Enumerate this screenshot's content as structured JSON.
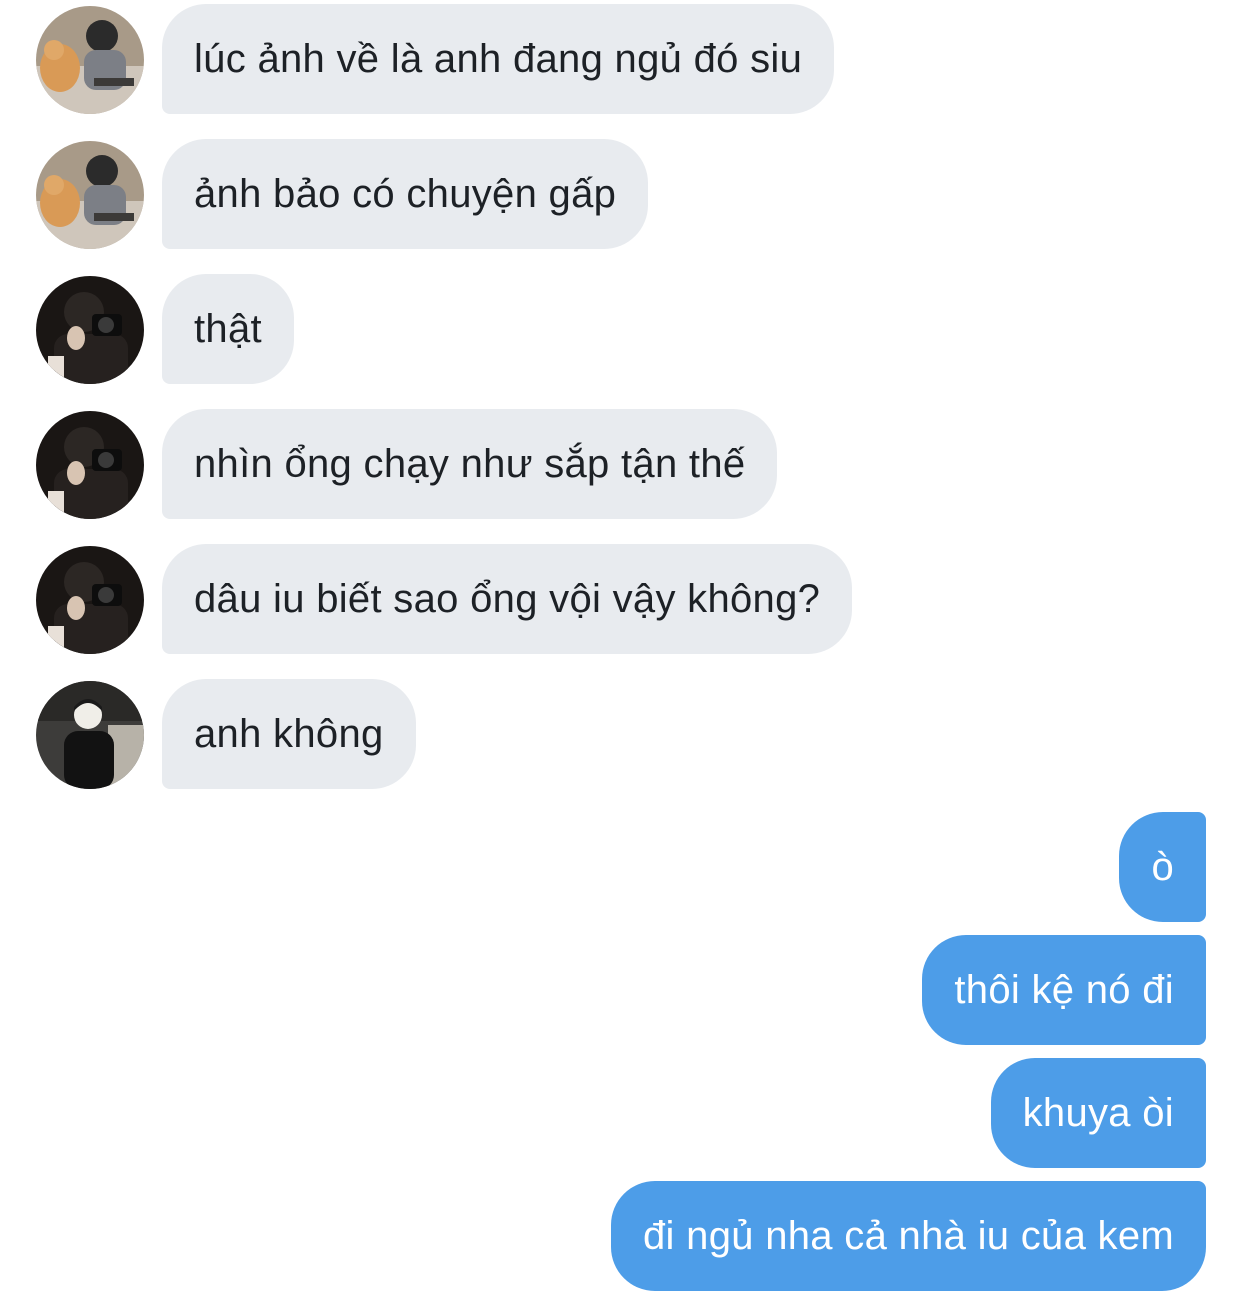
{
  "conversation": {
    "incoming": [
      {
        "avatar": "avatar-cat-boy-icon",
        "text": "lúc ảnh về là anh đang ngủ đó siu"
      },
      {
        "avatar": "avatar-cat-boy-icon",
        "text": "ảnh bảo có chuyện gấp"
      },
      {
        "avatar": "avatar-camera-boy-icon",
        "text": "thật"
      },
      {
        "avatar": "avatar-camera-boy-icon",
        "text": "nhìn ổng chạy như sắp tận thế"
      },
      {
        "avatar": "avatar-camera-boy-icon",
        "text": "dâu iu biết sao ổng vội vậy không?"
      },
      {
        "avatar": "avatar-dark-boy-icon",
        "text": "anh không"
      }
    ],
    "outgoing": [
      {
        "text": "ò"
      },
      {
        "text": "thôi kệ nó đi"
      },
      {
        "text": "khuya òi"
      },
      {
        "text": "đi ngủ nha cả nhà iu của kem"
      }
    ]
  },
  "colors": {
    "incoming_bubble": "#e8ebef",
    "incoming_text": "#1d2126",
    "outgoing_bubble": "#4d9de8",
    "outgoing_text": "#ffffff"
  }
}
